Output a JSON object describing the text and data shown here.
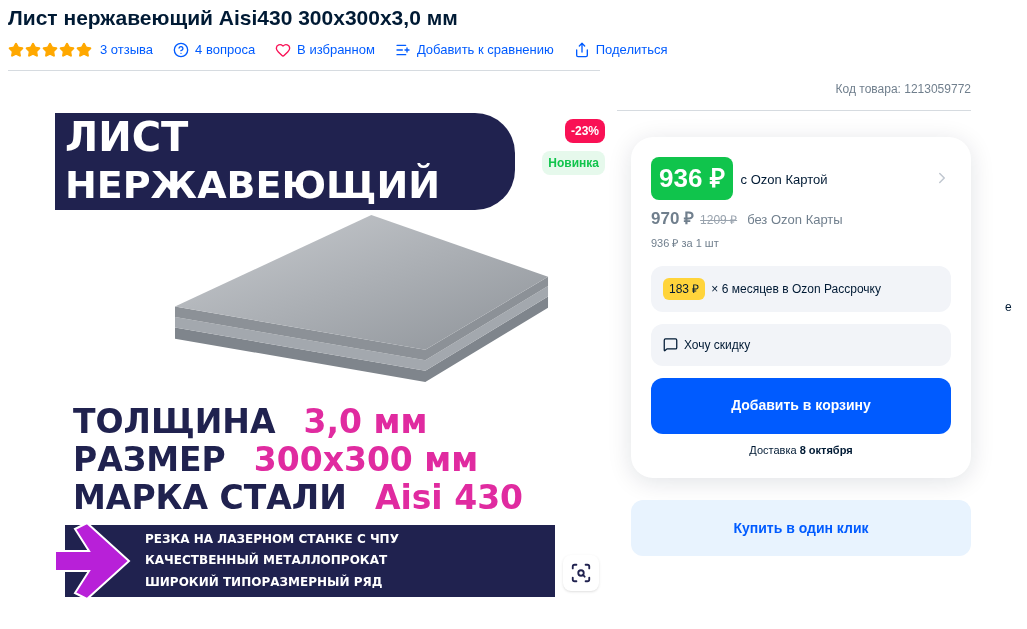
{
  "title": "Лист нержавеющий Aisi430 300x300x3,0 мм",
  "rating": {
    "stars": 5,
    "reviews": "3 отзыва"
  },
  "actions": [
    {
      "kind": "questions",
      "label": "4 вопроса"
    },
    {
      "kind": "favorite",
      "label": "В избранном",
      "selected": true
    },
    {
      "kind": "compare",
      "label": "Добавить к сравнению"
    },
    {
      "kind": "share",
      "label": "Поделиться"
    }
  ],
  "banner": {
    "heading": [
      "ЛИСТ",
      "НЕРЖАВЕЮЩИЙ"
    ],
    "specs": [
      {
        "name": "ТОЛЩИНА",
        "value": "3,0 мм"
      },
      {
        "name": "РАЗМЕР",
        "value": "300x300 мм"
      },
      {
        "name": "МАРКА СТАЛИ",
        "value": "Aisi 430"
      }
    ],
    "features": [
      "РЕЗКА НА ЛАЗЕРНОМ СТАНКЕ С ЧПУ",
      "КАЧЕСТВЕННЫЙ МЕТАЛЛОПРОКАТ",
      "ШИРОКИЙ ТИПОРАЗМЕРНЫЙ РЯД"
    ],
    "badges": [
      {
        "kind": "discount",
        "text": "-23%"
      },
      {
        "kind": "new",
        "text": "Новинка"
      }
    ]
  },
  "product_code": "Код товара: 1213059772",
  "price": {
    "card_price": "936 ₽",
    "card_label": "с Ozon Картой",
    "price": "970 ₽",
    "old_price": "1209 ₽",
    "no_card_label": "без Ozon Карты",
    "per_unit": "936 ₽ за 1 шт"
  },
  "installment": {
    "amount": "183 ₽",
    "text": "× 6 месяцев в Ozon Рассрочку"
  },
  "discount_request": "Хочу скидку",
  "add_to_cart": "Добавить в корзину",
  "delivery": "Доставка **8 октября**",
  "buy_one_click": "Купить в один клик",
  "edge_text": "е"
}
